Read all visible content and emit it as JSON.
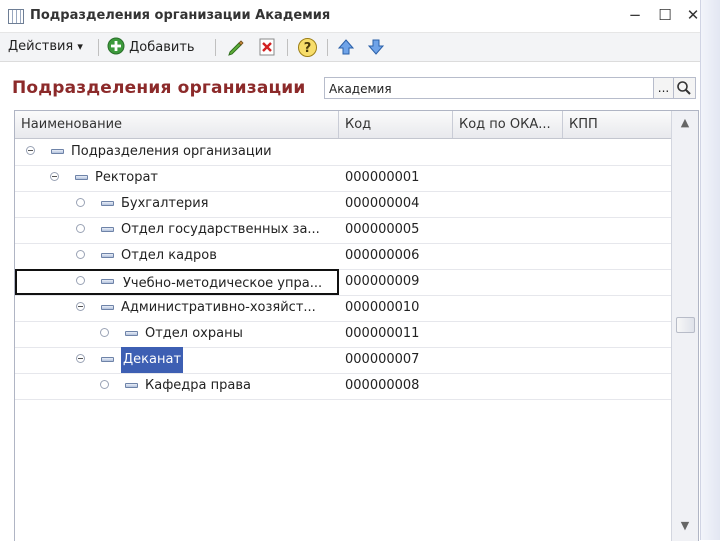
{
  "window": {
    "title": "Подразделения организации Академия",
    "minimize": "−",
    "maximize": "☐",
    "close": "✕"
  },
  "toolbar": {
    "actions_label": "Действия",
    "actions_arrow": "▾",
    "add_label": "Добавить"
  },
  "header": {
    "title": "Подразделения организации",
    "org_value": "Академия",
    "org_choose_label": "..."
  },
  "grid": {
    "columns": [
      "Наименование",
      "Код",
      "Код по ОКА...",
      "КПП"
    ],
    "rows": [
      {
        "name": "Подразделения организации",
        "code": "",
        "toggle": "minus",
        "level": 0
      },
      {
        "name": "Ректорат",
        "code": "000000001",
        "toggle": "minus",
        "level": 1
      },
      {
        "name": "Бухгалтерия",
        "code": "000000004",
        "toggle": "leaf",
        "level": 2
      },
      {
        "name": "Отдел государственных за...",
        "code": "000000005",
        "toggle": "leaf",
        "level": 2
      },
      {
        "name": "Отдел кадров",
        "code": "000000006",
        "toggle": "leaf",
        "level": 2
      },
      {
        "name": "Учебно-методическое упра...",
        "code": "000000009",
        "toggle": "leaf",
        "level": 2
      },
      {
        "name": "Административно-хозяйст...",
        "code": "000000010",
        "toggle": "minus",
        "level": 2
      },
      {
        "name": "Отдел охраны",
        "code": "000000011",
        "toggle": "leaf",
        "level": 3
      },
      {
        "name": "Деканат",
        "code": "000000007",
        "toggle": "minus",
        "level": 2
      },
      {
        "name": "Кафедра права",
        "code": "000000008",
        "toggle": "leaf",
        "level": 3
      }
    ],
    "selected_row_index": 5,
    "highlighted_row_index": 8
  },
  "scrollbar": {
    "up": "▲",
    "down": "▼"
  },
  "colors": {
    "title": "#8c2a2a",
    "selection": "#3d5fb3"
  }
}
